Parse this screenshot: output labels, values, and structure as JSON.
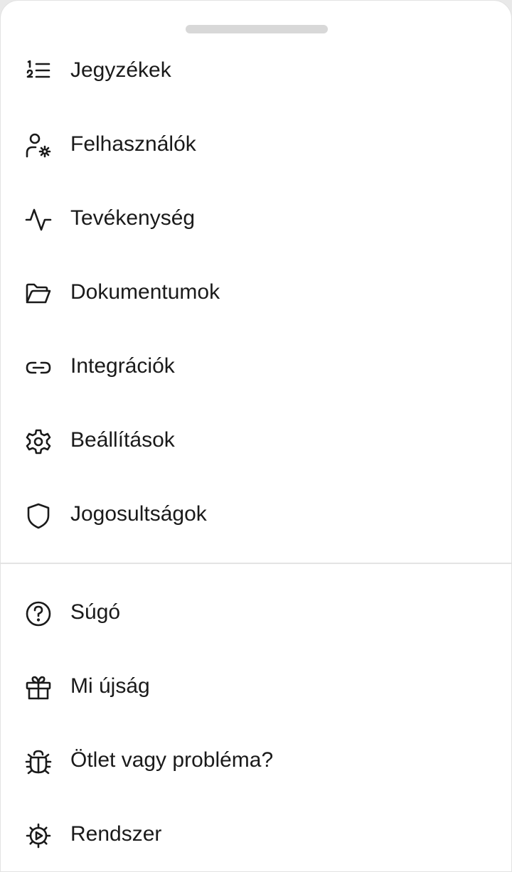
{
  "menu": {
    "primary": [
      {
        "label": "Jegyzékek",
        "icon": "numbered-list-icon"
      },
      {
        "label": "Felhasználók",
        "icon": "user-settings-icon"
      },
      {
        "label": "Tevékenység",
        "icon": "activity-icon"
      },
      {
        "label": "Dokumentumok",
        "icon": "folder-open-icon"
      },
      {
        "label": "Integrációk",
        "icon": "link-icon"
      },
      {
        "label": "Beállítások",
        "icon": "gear-icon"
      },
      {
        "label": "Jogosultságok",
        "icon": "shield-icon"
      }
    ],
    "secondary": [
      {
        "label": "Súgó",
        "icon": "help-circle-icon"
      },
      {
        "label": "Mi újság",
        "icon": "gift-icon"
      },
      {
        "label": "Ötlet vagy probléma?",
        "icon": "bug-icon"
      },
      {
        "label": "Rendszer",
        "icon": "system-gear-icon"
      }
    ]
  }
}
